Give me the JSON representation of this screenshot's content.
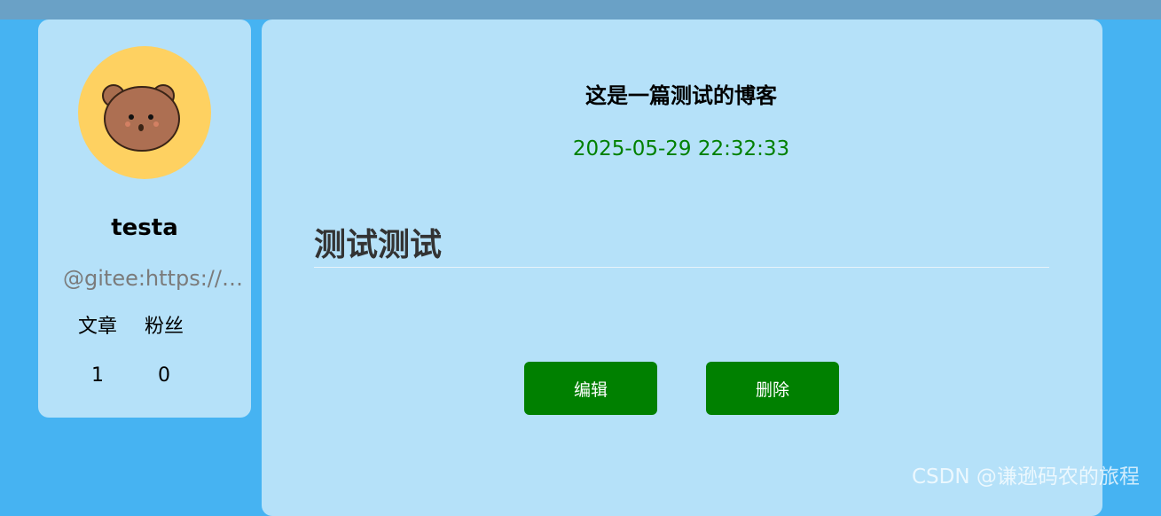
{
  "profile": {
    "username": "testa",
    "gitee": "@gitee:https://gi...",
    "stats": [
      {
        "label": "文章",
        "value": "1"
      },
      {
        "label": "粉丝",
        "value": "0"
      }
    ],
    "avatar_icon": "bear-avatar-icon"
  },
  "blog": {
    "title": "这是一篇测试的博客",
    "time": "2025-05-29 22:32:33",
    "content_heading": "测试测试",
    "edit_label": "编辑",
    "delete_label": "删除"
  },
  "watermark": "CSDN @谦逊码农的旅程",
  "colors": {
    "background": "#46b3f2",
    "topbar": "#6aa1c6",
    "card": "#b5e1f9",
    "avatar_bg": "#fed161",
    "button": "#008000",
    "time_text": "#008000"
  }
}
